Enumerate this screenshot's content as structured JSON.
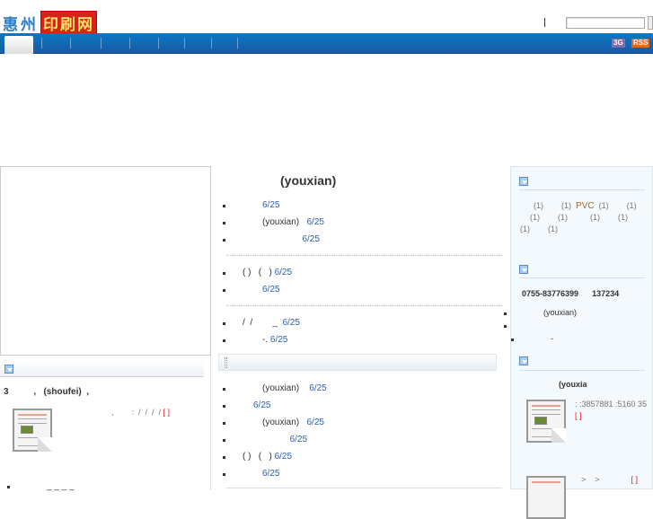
{
  "header": {
    "logo_part1": "惠州",
    "logo_part2": "印刷网",
    "separator": "|",
    "search_placeholder": ""
  },
  "nav": {
    "badge_3g": "3G",
    "badge_rss": "RSS"
  },
  "center": {
    "title": "(youxian)",
    "group1": [
      {
        "text": "",
        "date": "6/25"
      },
      {
        "text": "(youxian)",
        "date": "6/25"
      },
      {
        "text": "",
        "date": "6/25"
      }
    ],
    "group2": [
      {
        "text": "( )   (   )",
        "date": "6/25"
      },
      {
        "text": "",
        "date": "6/25"
      }
    ],
    "group3": [
      {
        "text": "/  /        _",
        "date": "6/25"
      },
      {
        "text": "-.",
        "date": "6/25"
      }
    ],
    "group4": [
      {
        "text": "(youxian)",
        "date": "6/25"
      },
      {
        "text": "",
        "date": "6/25"
      },
      {
        "text": "(youxian)",
        "date": "6/25"
      },
      {
        "text": "",
        "date": "6/25"
      },
      {
        "text": "( )   (   )",
        "date": "6/25"
      },
      {
        "text": "",
        "date": "6/25"
      }
    ]
  },
  "left": {
    "headline": "3          ,   (shoufei)  ,",
    "desc": ",        :  /  /  /  /",
    "bracket": "[ ]",
    "bullet": "_ _ _ _"
  },
  "right": {
    "tags": {
      "row1": "(1)        (1)",
      "pvc": "PVC",
      "row1b": "(1)        (1)",
      "row2": "(1)        (1)          (1)        (1)",
      "row3": "(1)        (1)"
    },
    "phone": "0755-83776399      137234",
    "contacts": [
      "(youxian)",
      "",
      "-"
    ],
    "company": "(youxia",
    "info": ":  :3857881  :5160 35",
    "info_bracket": "[ ]",
    "item2": ">    >",
    "item2_bracket": "[ ]"
  }
}
